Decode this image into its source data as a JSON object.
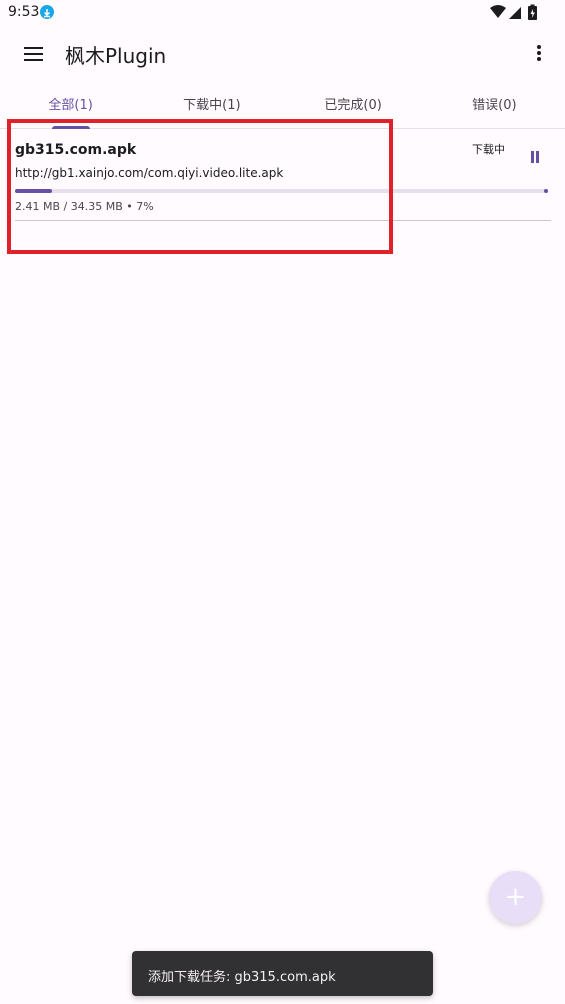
{
  "status_bar": {
    "time": "9:53",
    "icons": [
      "download-notification-icon",
      "wifi-icon",
      "signal-icon",
      "battery-icon"
    ]
  },
  "app_bar": {
    "title": "枫木Plugin",
    "icons": [
      "menu-icon",
      "more-vert-icon"
    ]
  },
  "tabs": [
    {
      "label": "全部(1)",
      "active": true
    },
    {
      "label": "下载中(1)",
      "active": false
    },
    {
      "label": "已完成(0)",
      "active": false
    },
    {
      "label": "错误(0)",
      "active": false
    }
  ],
  "tasks": [
    {
      "file_name": "gb315.com.apk",
      "url": "http://gb1.xainjo.com/com.qiyi.video.lite.apk",
      "status": "下载中",
      "size_text": "2.41 MB / 34.35 MB • 7%",
      "progress": 0.07,
      "action_icon": "pause-icon"
    }
  ],
  "fab": {
    "icon": "plus-icon"
  },
  "snackbar": {
    "text": "添加下载任务: gb315.com.apk"
  },
  "colors": {
    "accent": "#6750a4",
    "background": "#fffbfe",
    "highlight": "#e0212a",
    "fab": "#e8def8",
    "snackbar": "#313033"
  }
}
